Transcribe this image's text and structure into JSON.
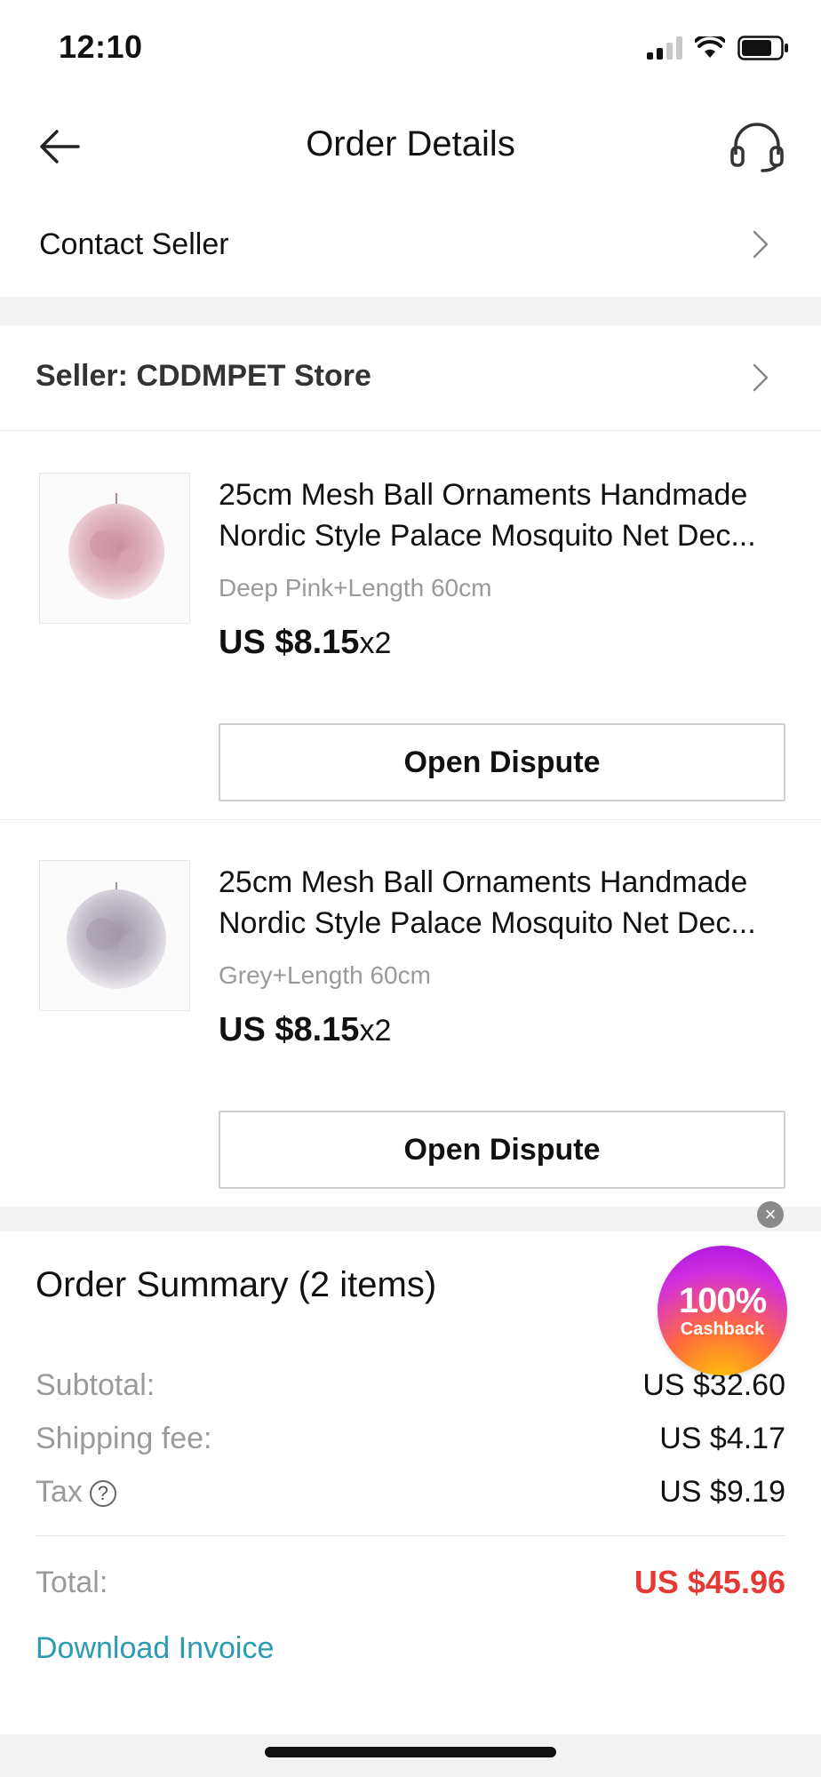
{
  "status": {
    "time": "12:10"
  },
  "header": {
    "title": "Order Details"
  },
  "contact": {
    "label": "Contact Seller"
  },
  "seller": {
    "label": "Seller: CDDMPET Store"
  },
  "items": [
    {
      "title_line1": "25cm Mesh Ball Ornaments Handmade",
      "title_line2": "Nordic Style Palace Mosquito Net Dec...",
      "variant": "Deep Pink+Length 60cm",
      "price": "US $8.15",
      "qty": "x2",
      "button": "Open Dispute",
      "color": "#d8a9b4"
    },
    {
      "title_line1": "25cm Mesh Ball Ornaments Handmade",
      "title_line2": "Nordic Style Palace Mosquito Net Dec...",
      "variant": "Grey+Length 60cm",
      "price": "US $8.15",
      "qty": "x2",
      "button": "Open Dispute",
      "color": "#b7b0bc"
    }
  ],
  "summary": {
    "title": "Order Summary (2 items)",
    "rows": [
      {
        "label": "Subtotal:",
        "value": "US $32.60"
      },
      {
        "label": "Shipping fee:",
        "value": "US $4.17"
      },
      {
        "label": "Tax",
        "value": "US $9.19"
      }
    ],
    "total_label": "Total:",
    "total_value": "US $45.96",
    "invoice": "Download Invoice"
  },
  "cashback": {
    "percent": "100%",
    "label": "Cashback"
  },
  "colors": {
    "accent_red": "#e53935",
    "link": "#2a9bb0",
    "muted": "#9a9a9a"
  }
}
